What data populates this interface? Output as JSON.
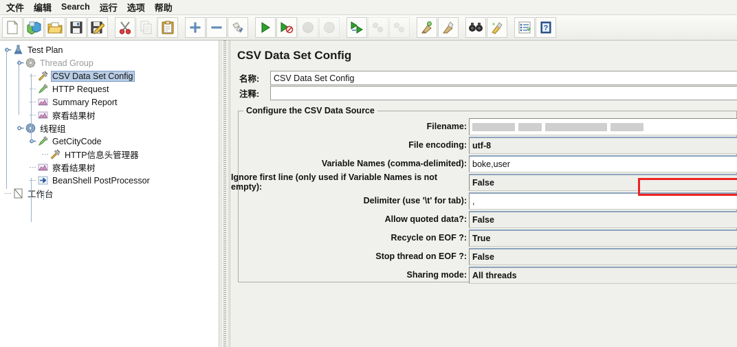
{
  "window": {
    "title": "CSV Data Set Config"
  },
  "menubar": {
    "items": [
      {
        "label": "文件",
        "name": "menu-file"
      },
      {
        "label": "编辑",
        "name": "menu-edit"
      },
      {
        "label": "Search",
        "name": "menu-search"
      },
      {
        "label": "运行",
        "name": "menu-run"
      },
      {
        "label": "选项",
        "name": "menu-options"
      },
      {
        "label": "帮助",
        "name": "menu-help"
      }
    ]
  },
  "toolbar": {
    "buttons": [
      {
        "name": "new-icon",
        "title": "New",
        "framed": true,
        "disabled": false
      },
      {
        "name": "templates-icon",
        "title": "Templates",
        "framed": true,
        "disabled": false
      },
      {
        "name": "open-icon",
        "title": "Open",
        "framed": true,
        "disabled": false
      },
      {
        "name": "save-icon",
        "title": "Save",
        "framed": true,
        "disabled": false
      },
      {
        "name": "save-as-icon",
        "title": "Save As",
        "framed": true,
        "disabled": false
      },
      {
        "name": "separator-1",
        "title": "",
        "framed": false,
        "disabled": false
      },
      {
        "name": "cut-icon",
        "title": "Cut",
        "framed": true,
        "disabled": false
      },
      {
        "name": "copy-icon",
        "title": "Copy",
        "framed": true,
        "disabled": true
      },
      {
        "name": "paste-icon",
        "title": "Paste",
        "framed": true,
        "disabled": false
      },
      {
        "name": "separator-2",
        "title": "",
        "framed": false,
        "disabled": false
      },
      {
        "name": "expand-all-icon",
        "title": "Expand All",
        "framed": true,
        "disabled": false
      },
      {
        "name": "collapse-all-icon",
        "title": "Collapse All",
        "framed": true,
        "disabled": false
      },
      {
        "name": "toggle-icon",
        "title": "Toggle",
        "framed": true,
        "disabled": false
      },
      {
        "name": "separator-3",
        "title": "",
        "framed": false,
        "disabled": false
      },
      {
        "name": "start-icon",
        "title": "Start",
        "framed": true,
        "disabled": false
      },
      {
        "name": "start-no-timers-icon",
        "title": "Start no pauses",
        "framed": true,
        "disabled": false
      },
      {
        "name": "stop-icon",
        "title": "Stop",
        "framed": true,
        "disabled": true
      },
      {
        "name": "shutdown-icon",
        "title": "Shutdown",
        "framed": true,
        "disabled": true
      },
      {
        "name": "separator-4",
        "title": "",
        "framed": false,
        "disabled": false
      },
      {
        "name": "remote-start-all-icon",
        "title": "Remote Start All",
        "framed": true,
        "disabled": false
      },
      {
        "name": "remote-stop-all-icon",
        "title": "Remote Stop All",
        "framed": true,
        "disabled": true
      },
      {
        "name": "remote-shutdown-all-icon",
        "title": "Remote Shutdown All",
        "framed": true,
        "disabled": true
      },
      {
        "name": "separator-5",
        "title": "",
        "framed": false,
        "disabled": false
      },
      {
        "name": "clear-icon",
        "title": "Clear",
        "framed": true,
        "disabled": false
      },
      {
        "name": "clear-all-icon",
        "title": "Clear All",
        "framed": true,
        "disabled": false
      },
      {
        "name": "separator-6",
        "title": "",
        "framed": false,
        "disabled": false
      },
      {
        "name": "search-icon",
        "title": "Search",
        "framed": true,
        "disabled": false
      },
      {
        "name": "search-reset-icon",
        "title": "Reset Search",
        "framed": true,
        "disabled": false
      },
      {
        "name": "separator-7",
        "title": "",
        "framed": false,
        "disabled": false
      },
      {
        "name": "function-helper-icon",
        "title": "Function Helper Dialog",
        "framed": true,
        "disabled": false
      },
      {
        "name": "help-icon",
        "title": "Help",
        "framed": true,
        "disabled": false
      }
    ]
  },
  "tree": {
    "nodes": [
      {
        "label": "Test Plan",
        "icon": "test-plan-icon",
        "depth": 0,
        "selected": false,
        "muted": false,
        "expander": "expanded"
      },
      {
        "label": "Thread Group",
        "icon": "thread-group-icon",
        "depth": 1,
        "selected": false,
        "muted": true,
        "expander": "expanded"
      },
      {
        "label": "CSV Data Set Config",
        "icon": "config-element-icon",
        "depth": 2,
        "selected": true,
        "muted": false,
        "expander": "none"
      },
      {
        "label": "HTTP Request",
        "icon": "sampler-icon",
        "depth": 2,
        "selected": false,
        "muted": false,
        "expander": "none"
      },
      {
        "label": "Summary Report",
        "icon": "listener-icon",
        "depth": 2,
        "selected": false,
        "muted": false,
        "expander": "none"
      },
      {
        "label": "察看结果树",
        "icon": "listener-icon",
        "depth": 2,
        "selected": false,
        "muted": false,
        "expander": "none"
      },
      {
        "label": "线程组",
        "icon": "thread-group-icon",
        "depth": 1,
        "selected": false,
        "muted": false,
        "expander": "expanded"
      },
      {
        "label": "GetCityCode",
        "icon": "sampler-icon",
        "depth": 2,
        "selected": false,
        "muted": false,
        "expander": "expanded"
      },
      {
        "label": "HTTP信息头管理器",
        "icon": "config-element-icon",
        "depth": 3,
        "selected": false,
        "muted": false,
        "expander": "none"
      },
      {
        "label": "察看结果树",
        "icon": "listener-icon",
        "depth": 2,
        "selected": false,
        "muted": false,
        "expander": "none"
      },
      {
        "label": "BeanShell PostProcessor",
        "icon": "post-processor-icon",
        "depth": 2,
        "selected": false,
        "muted": false,
        "expander": "none"
      },
      {
        "label": "工作台",
        "icon": "workbench-icon",
        "depth": 0,
        "selected": false,
        "muted": false,
        "expander": "none"
      }
    ]
  },
  "main": {
    "title": "CSV Data Set Config",
    "name_label": "名称:",
    "name_value": "CSV Data Set Config",
    "comment_label": "注释:",
    "comment_value": "",
    "group_legend": "Configure the CSV Data Source",
    "fields": [
      {
        "label": "Filename:",
        "value": "",
        "kind": "filename",
        "name": "filename-field",
        "redacted": true
      },
      {
        "label": "File encoding:",
        "value": "utf-8",
        "kind": "combo",
        "name": "file-encoding-field",
        "redacted": false
      },
      {
        "label": "Variable Names (comma-delimited):",
        "value": "boke,user",
        "kind": "text",
        "name": "variable-names-field",
        "redacted": false
      },
      {
        "label": "Ignore first line (only used if Variable Names is not empty):",
        "value": "False",
        "kind": "combo",
        "name": "ignore-first-line-select",
        "redacted": false
      },
      {
        "label": "Delimiter (use '\\t' for tab):",
        "value": ",",
        "kind": "text",
        "name": "delimiter-field",
        "redacted": false
      },
      {
        "label": "Allow quoted data?:",
        "value": "False",
        "kind": "combo",
        "name": "allow-quoted-data-select",
        "redacted": false
      },
      {
        "label": "Recycle on EOF ?:",
        "value": "True",
        "kind": "combo",
        "name": "recycle-on-eof-select",
        "redacted": false
      },
      {
        "label": "Stop thread on EOF ?:",
        "value": "False",
        "kind": "combo",
        "name": "stop-thread-on-eof-select",
        "redacted": false
      },
      {
        "label": "Sharing mode:",
        "value": "All threads",
        "kind": "combo",
        "name": "sharing-mode-select",
        "redacted": false
      }
    ]
  },
  "annotation": {
    "color": "#ee2222",
    "target": "File encoding: utf-8"
  }
}
